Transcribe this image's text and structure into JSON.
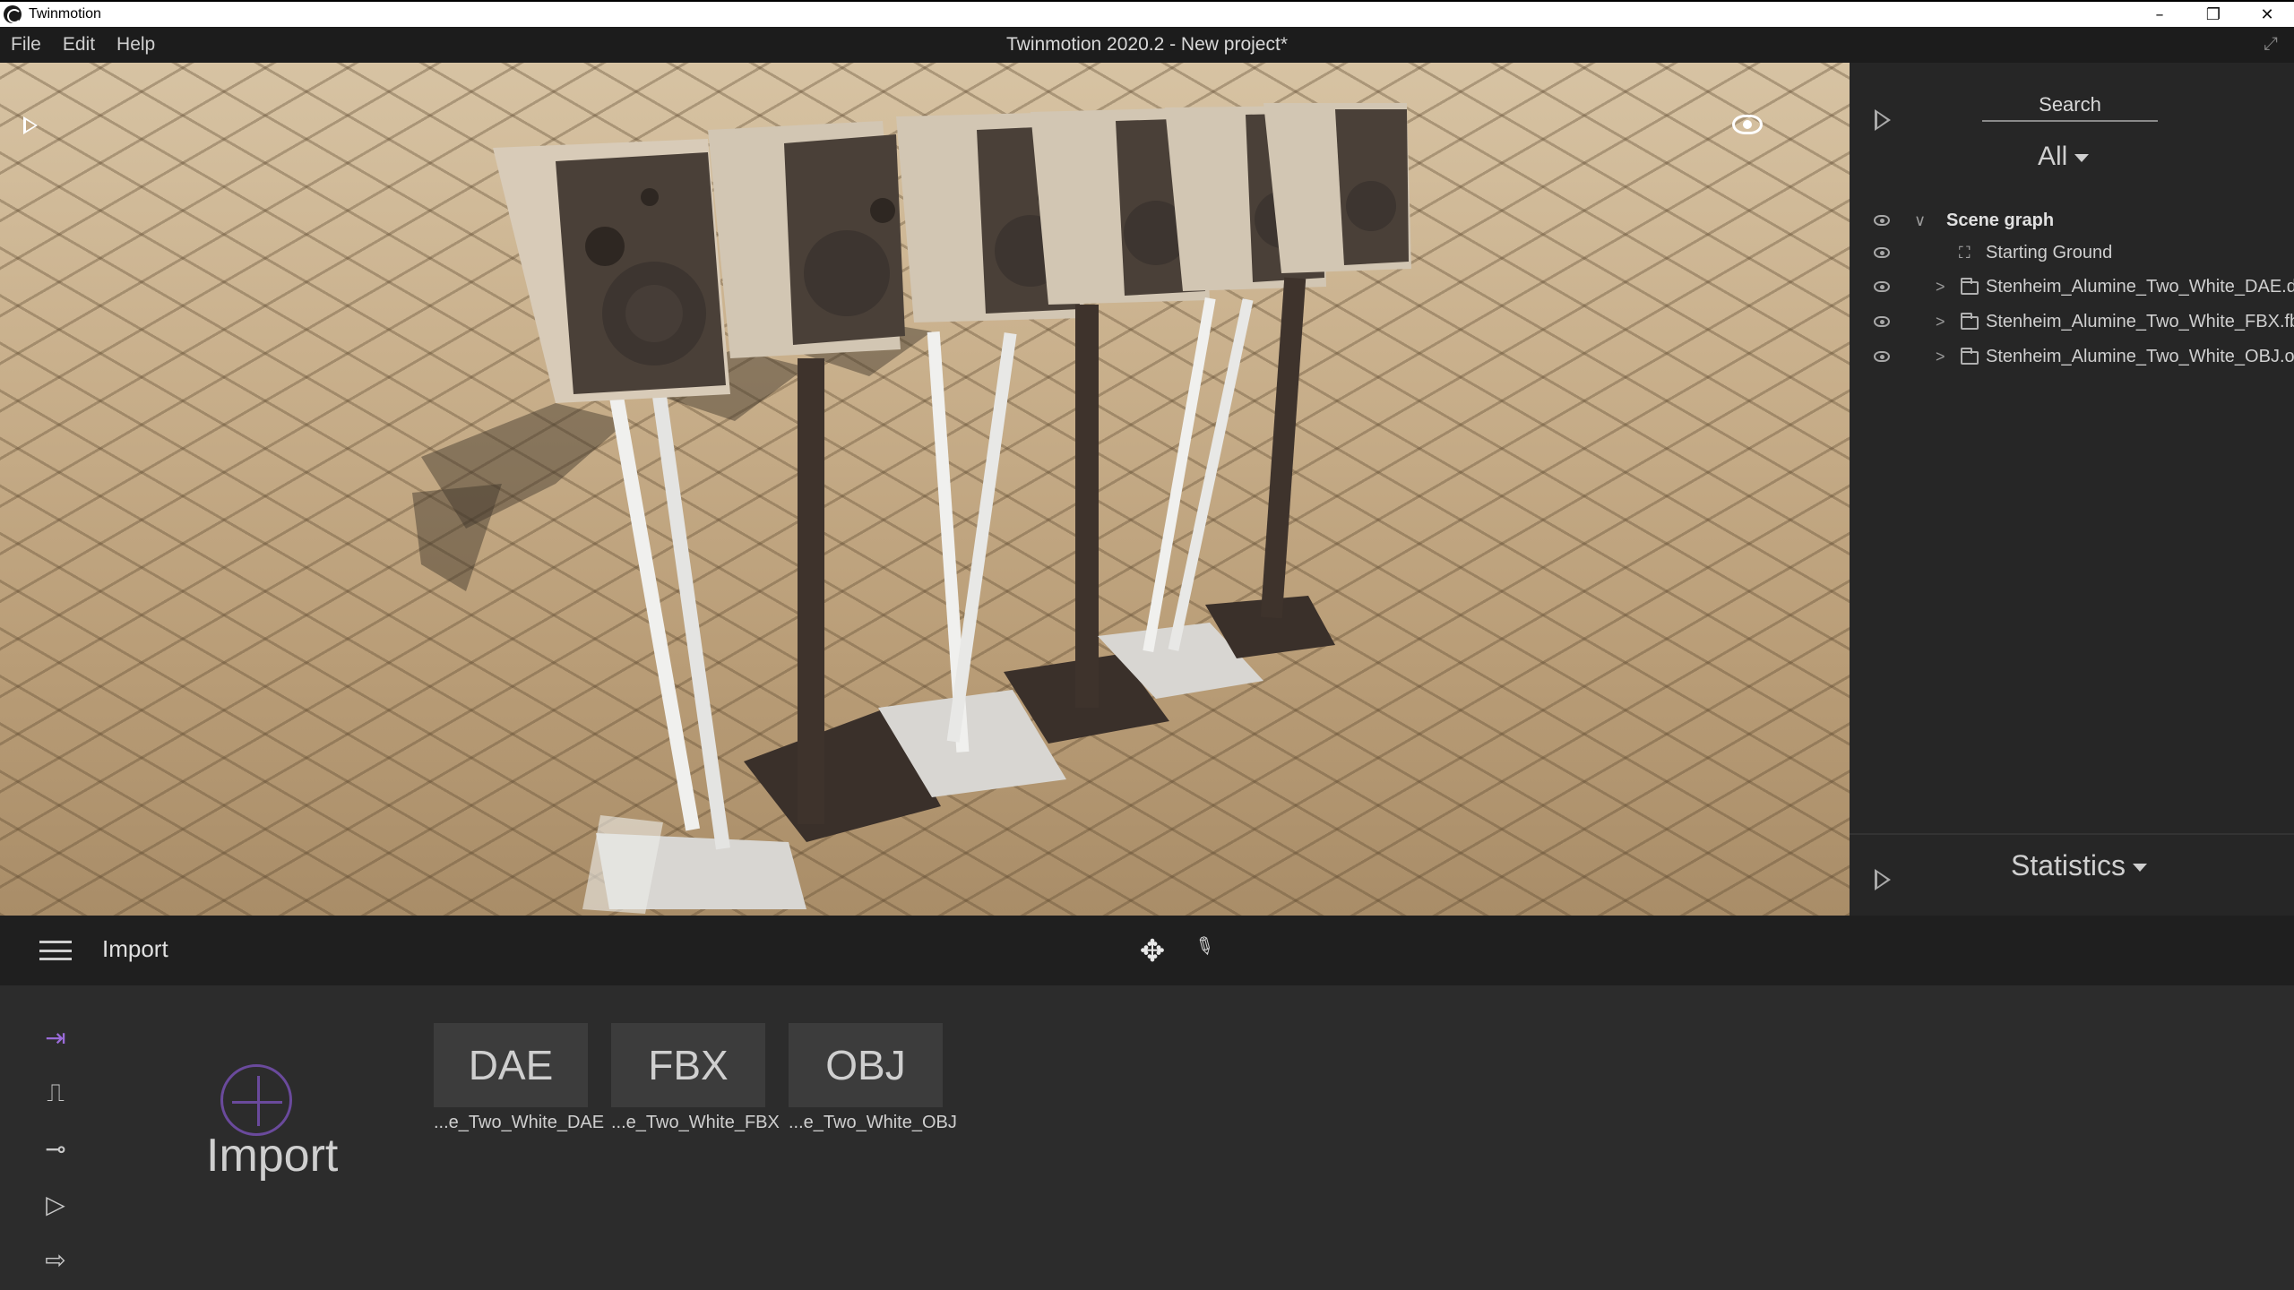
{
  "window": {
    "app_name": "Twinmotion",
    "controls": {
      "minimize": "–",
      "restore": "❐",
      "close": "✕"
    }
  },
  "menubar": {
    "items": [
      "File",
      "Edit",
      "Help"
    ],
    "document_title": "Twinmotion 2020.2 - New project*",
    "fullscreen_icon": "⤢"
  },
  "viewport": {
    "play_icon": "play-icon",
    "eye_icon": "eye-icon"
  },
  "right_panel": {
    "search_placeholder": "Search",
    "filter_label": "All",
    "scene_graph": [
      {
        "label": "Scene graph",
        "type": "root",
        "expanded": true
      },
      {
        "label": "Starting Ground",
        "type": "ground"
      },
      {
        "label": "Stenheim_Alumine_Two_White_DAE.dae",
        "type": "folder",
        "expanded": false
      },
      {
        "label": "Stenheim_Alumine_Two_White_FBX.fbx",
        "type": "folder",
        "expanded": false
      },
      {
        "label": "Stenheim_Alumine_Two_White_OBJ.obj",
        "type": "folder",
        "expanded": false
      }
    ],
    "statistics_label": "Statistics"
  },
  "bottom_toolbar": {
    "section_title": "Import",
    "move_icon": "✥",
    "picker_icon": "✎"
  },
  "bottom_panel": {
    "side_icons": [
      {
        "name": "import-icon",
        "glyph": "⇥",
        "active": true
      },
      {
        "name": "context-icon",
        "glyph": "⎍",
        "active": false
      },
      {
        "name": "configure-icon",
        "glyph": "⊸",
        "active": false
      },
      {
        "name": "media-icon",
        "glyph": "▷",
        "active": false
      },
      {
        "name": "export-icon",
        "glyph": "⇨",
        "active": false
      }
    ],
    "import_label": "Import",
    "assets": [
      {
        "ext": "DAE",
        "name": "...e_Two_White_DAE"
      },
      {
        "ext": "FBX",
        "name": "...e_Two_White_FBX"
      },
      {
        "ext": "OBJ",
        "name": "...e_Two_White_OBJ"
      }
    ]
  },
  "colors": {
    "accent": "#9a6bd8",
    "panel_bg": "#262626",
    "toolbar_bg": "#1f1f1f"
  }
}
